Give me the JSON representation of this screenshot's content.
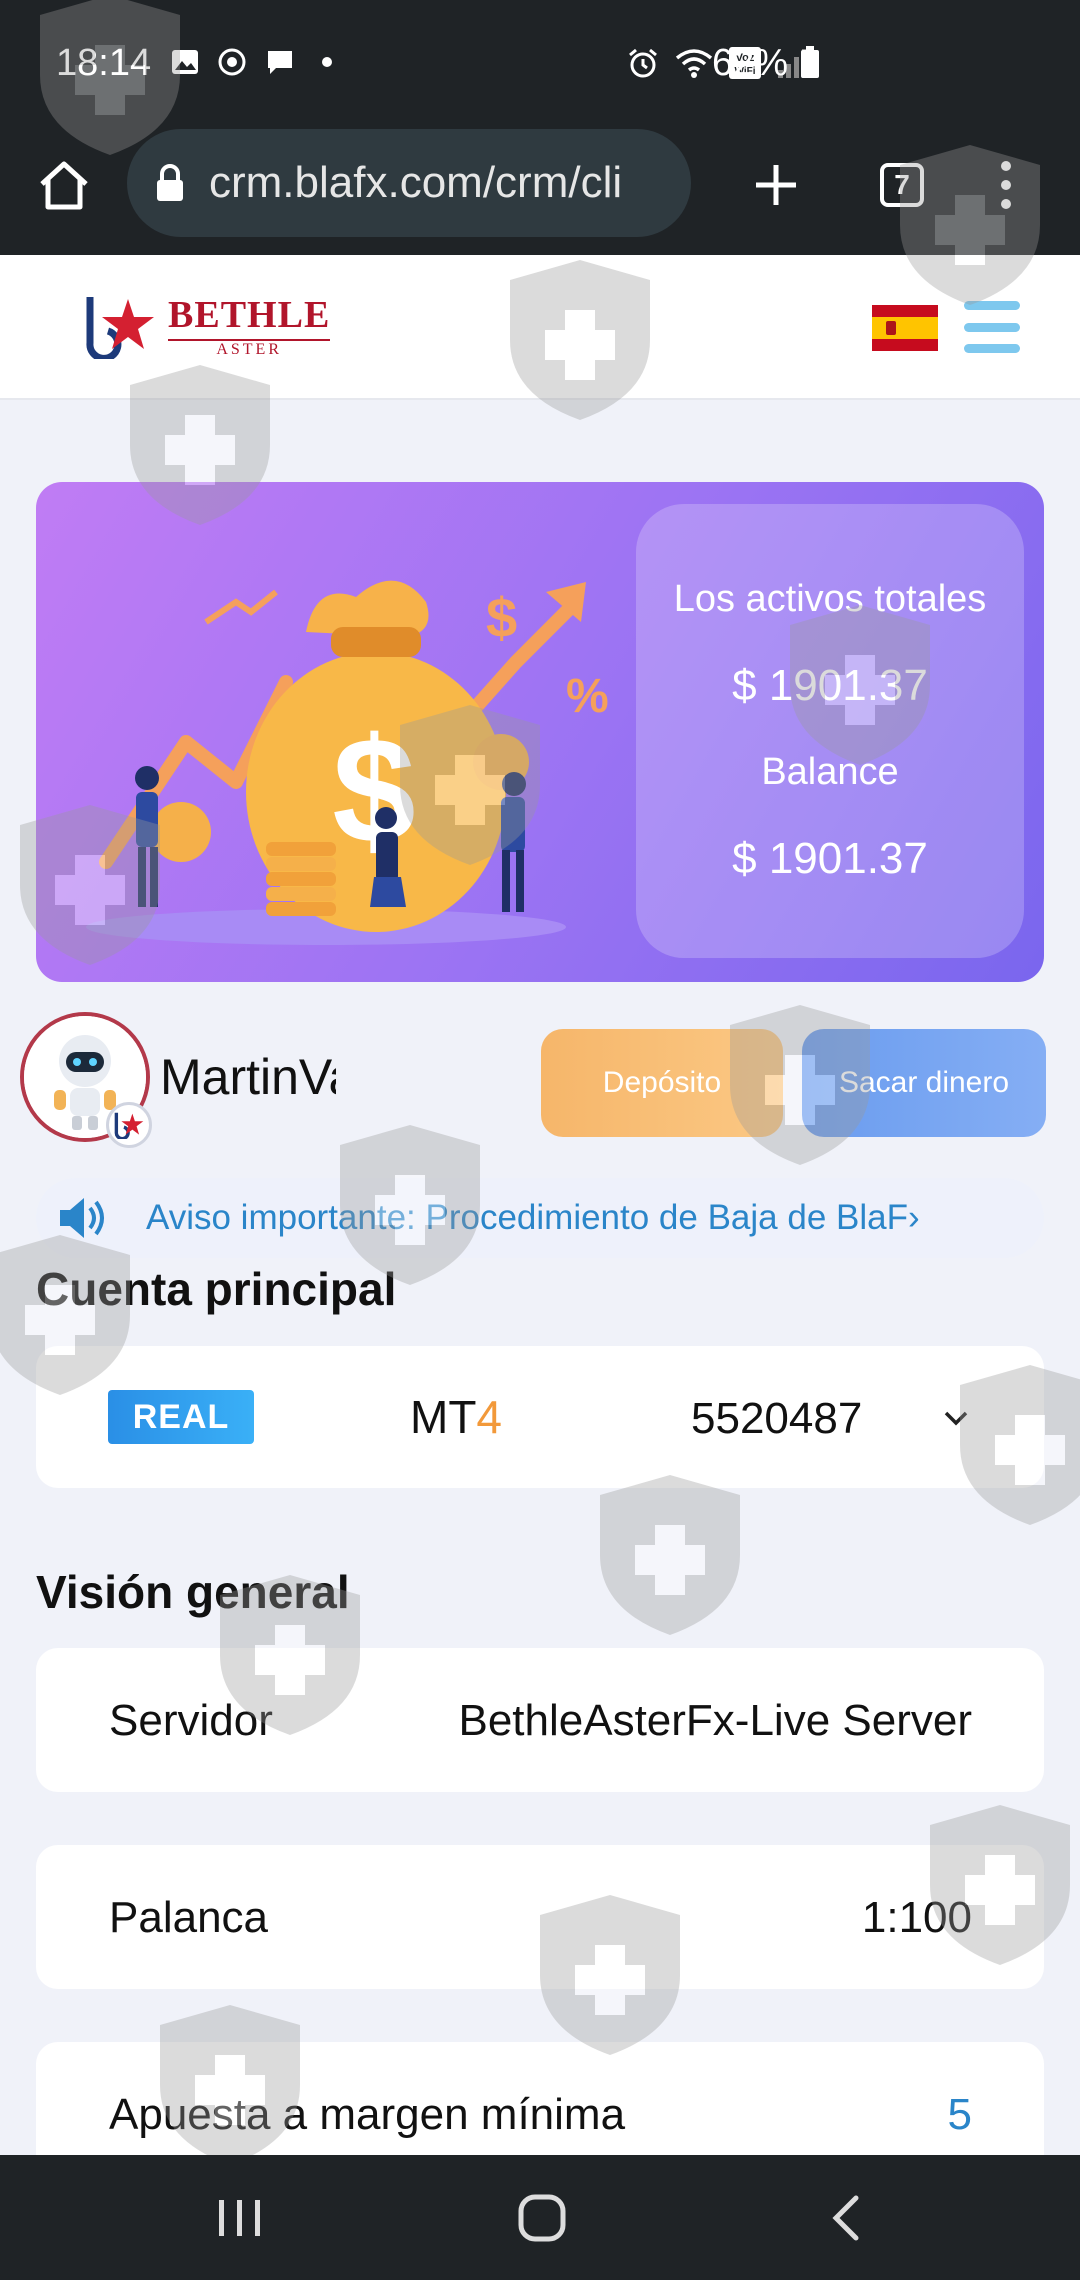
{
  "status_bar": {
    "time": "18:14",
    "battery": "62%",
    "icons_left": [
      "image-icon",
      "sync-icon",
      "message-icon",
      "dot-icon"
    ],
    "icons_right": [
      "alarm-icon",
      "wifi-icon",
      "vowifi-icon",
      "signal-icon"
    ],
    "vowifi_label": "Voz WiFi"
  },
  "browser": {
    "url": "crm.blafx.com/crm/cli",
    "tab_count": "7"
  },
  "header": {
    "logo_main": "BETHLE",
    "logo_sub": "ASTER"
  },
  "hero": {
    "total_assets_label": "Los activos totales",
    "total_assets_value": "$ 1901.37",
    "balance_label": "Balance",
    "balance_value": "$ 1901.37"
  },
  "user": {
    "name": "MartinVa",
    "deposit_label": "Depósito",
    "withdraw_label": "Sacar dinero"
  },
  "notice": {
    "text": "Aviso importante: Procedimiento de Baja de BlaF›"
  },
  "main_account": {
    "title": "Cuenta principal",
    "type_badge": "REAL",
    "platform_prefix": "MT",
    "platform_suffix": "4",
    "account_number": "5520487"
  },
  "overview": {
    "title": "Visión general",
    "rows": [
      {
        "label": "Servidor",
        "value": "BethleAsterFx-Live Server"
      },
      {
        "label": "Palanca",
        "value": "1:100"
      },
      {
        "label": "Apuesta a margen mínima",
        "value": "5"
      }
    ]
  },
  "colors": {
    "accent_blue": "#2a85c9",
    "brand_red": "#b1152b",
    "mt4_orange": "#f2993a"
  }
}
